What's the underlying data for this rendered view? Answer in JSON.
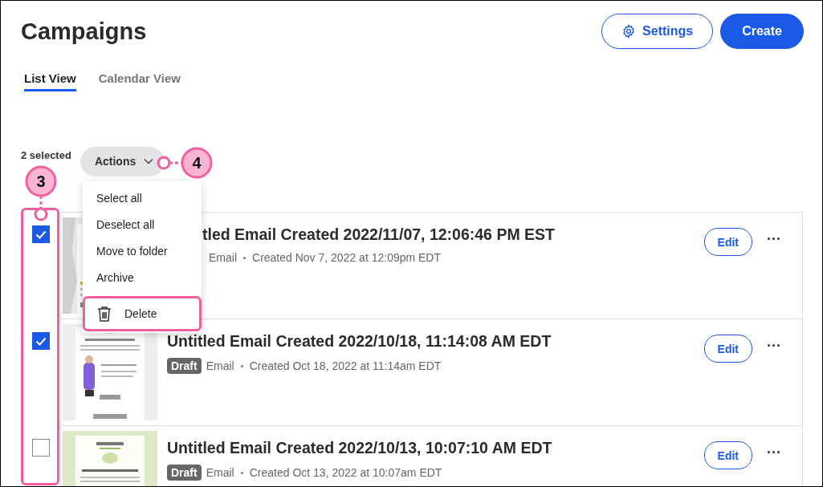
{
  "header": {
    "title": "Campaigns",
    "buttons": [
      {
        "label": "Settings",
        "kind": "outline"
      },
      {
        "label": "Create",
        "kind": "primary"
      }
    ]
  },
  "tabs": [
    {
      "label": "List View",
      "selected": true
    },
    {
      "label": "Calendar View",
      "selected": false
    }
  ],
  "selection": {
    "count": "2 selected",
    "actions": "Actions"
  },
  "menu": {
    "items": [
      {
        "label": "Select all",
        "kind": "plain",
        "highlighted": false
      },
      {
        "label": "Deselect all",
        "kind": "plain",
        "highlighted": false
      },
      {
        "label": "Move to folder",
        "kind": "plain",
        "highlighted": false
      },
      {
        "label": "Archive",
        "kind": "plain",
        "highlighted": false
      },
      {
        "label": "Delete",
        "kind": "delete",
        "highlighted": true
      }
    ]
  },
  "rows": [
    {
      "checked": true,
      "title": "tled Email Created 2022/11/07, 12:06:46 PM EST",
      "type": "Email",
      "created": "Created Nov 7, 2022 at 12:09pm EDT",
      "edit": "Edit",
      "more": "···"
    },
    {
      "checked": true,
      "title": "Untitled Email Created 2022/10/18, 11:14:08 AM EDT",
      "badge": "Draft",
      "type": "Email",
      "created": "Created Oct 18, 2022 at 11:14am EDT",
      "edit": "Edit",
      "more": "···"
    },
    {
      "checked": false,
      "title": "Untitled Email Created 2022/10/13, 10:07:10 AM EDT",
      "badge": "Draft",
      "type": "Email",
      "created": "Created Oct 13, 2022 at 10:07am EDT",
      "edit": "Edit",
      "more": "···"
    }
  ],
  "annotations": [
    {
      "label": "3"
    },
    {
      "label": "4"
    }
  ]
}
